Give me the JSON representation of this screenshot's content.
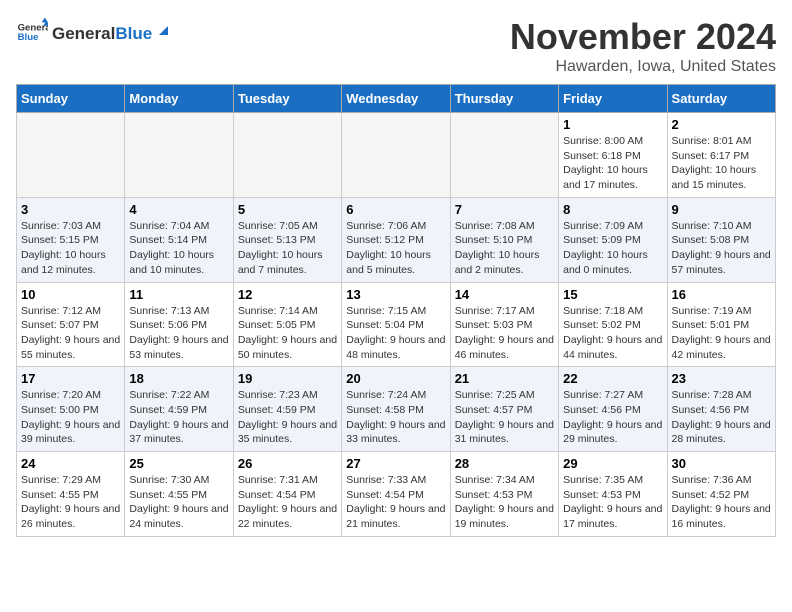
{
  "logo": {
    "general": "General",
    "blue": "Blue"
  },
  "header": {
    "month": "November 2024",
    "location": "Hawarden, Iowa, United States"
  },
  "weekdays": [
    "Sunday",
    "Monday",
    "Tuesday",
    "Wednesday",
    "Thursday",
    "Friday",
    "Saturday"
  ],
  "weeks": [
    [
      {
        "day": "",
        "text": ""
      },
      {
        "day": "",
        "text": ""
      },
      {
        "day": "",
        "text": ""
      },
      {
        "day": "",
        "text": ""
      },
      {
        "day": "",
        "text": ""
      },
      {
        "day": "1",
        "text": "Sunrise: 8:00 AM\nSunset: 6:18 PM\nDaylight: 10 hours and 17 minutes."
      },
      {
        "day": "2",
        "text": "Sunrise: 8:01 AM\nSunset: 6:17 PM\nDaylight: 10 hours and 15 minutes."
      }
    ],
    [
      {
        "day": "3",
        "text": "Sunrise: 7:03 AM\nSunset: 5:15 PM\nDaylight: 10 hours and 12 minutes."
      },
      {
        "day": "4",
        "text": "Sunrise: 7:04 AM\nSunset: 5:14 PM\nDaylight: 10 hours and 10 minutes."
      },
      {
        "day": "5",
        "text": "Sunrise: 7:05 AM\nSunset: 5:13 PM\nDaylight: 10 hours and 7 minutes."
      },
      {
        "day": "6",
        "text": "Sunrise: 7:06 AM\nSunset: 5:12 PM\nDaylight: 10 hours and 5 minutes."
      },
      {
        "day": "7",
        "text": "Sunrise: 7:08 AM\nSunset: 5:10 PM\nDaylight: 10 hours and 2 minutes."
      },
      {
        "day": "8",
        "text": "Sunrise: 7:09 AM\nSunset: 5:09 PM\nDaylight: 10 hours and 0 minutes."
      },
      {
        "day": "9",
        "text": "Sunrise: 7:10 AM\nSunset: 5:08 PM\nDaylight: 9 hours and 57 minutes."
      }
    ],
    [
      {
        "day": "10",
        "text": "Sunrise: 7:12 AM\nSunset: 5:07 PM\nDaylight: 9 hours and 55 minutes."
      },
      {
        "day": "11",
        "text": "Sunrise: 7:13 AM\nSunset: 5:06 PM\nDaylight: 9 hours and 53 minutes."
      },
      {
        "day": "12",
        "text": "Sunrise: 7:14 AM\nSunset: 5:05 PM\nDaylight: 9 hours and 50 minutes."
      },
      {
        "day": "13",
        "text": "Sunrise: 7:15 AM\nSunset: 5:04 PM\nDaylight: 9 hours and 48 minutes."
      },
      {
        "day": "14",
        "text": "Sunrise: 7:17 AM\nSunset: 5:03 PM\nDaylight: 9 hours and 46 minutes."
      },
      {
        "day": "15",
        "text": "Sunrise: 7:18 AM\nSunset: 5:02 PM\nDaylight: 9 hours and 44 minutes."
      },
      {
        "day": "16",
        "text": "Sunrise: 7:19 AM\nSunset: 5:01 PM\nDaylight: 9 hours and 42 minutes."
      }
    ],
    [
      {
        "day": "17",
        "text": "Sunrise: 7:20 AM\nSunset: 5:00 PM\nDaylight: 9 hours and 39 minutes."
      },
      {
        "day": "18",
        "text": "Sunrise: 7:22 AM\nSunset: 4:59 PM\nDaylight: 9 hours and 37 minutes."
      },
      {
        "day": "19",
        "text": "Sunrise: 7:23 AM\nSunset: 4:59 PM\nDaylight: 9 hours and 35 minutes."
      },
      {
        "day": "20",
        "text": "Sunrise: 7:24 AM\nSunset: 4:58 PM\nDaylight: 9 hours and 33 minutes."
      },
      {
        "day": "21",
        "text": "Sunrise: 7:25 AM\nSunset: 4:57 PM\nDaylight: 9 hours and 31 minutes."
      },
      {
        "day": "22",
        "text": "Sunrise: 7:27 AM\nSunset: 4:56 PM\nDaylight: 9 hours and 29 minutes."
      },
      {
        "day": "23",
        "text": "Sunrise: 7:28 AM\nSunset: 4:56 PM\nDaylight: 9 hours and 28 minutes."
      }
    ],
    [
      {
        "day": "24",
        "text": "Sunrise: 7:29 AM\nSunset: 4:55 PM\nDaylight: 9 hours and 26 minutes."
      },
      {
        "day": "25",
        "text": "Sunrise: 7:30 AM\nSunset: 4:55 PM\nDaylight: 9 hours and 24 minutes."
      },
      {
        "day": "26",
        "text": "Sunrise: 7:31 AM\nSunset: 4:54 PM\nDaylight: 9 hours and 22 minutes."
      },
      {
        "day": "27",
        "text": "Sunrise: 7:33 AM\nSunset: 4:54 PM\nDaylight: 9 hours and 21 minutes."
      },
      {
        "day": "28",
        "text": "Sunrise: 7:34 AM\nSunset: 4:53 PM\nDaylight: 9 hours and 19 minutes."
      },
      {
        "day": "29",
        "text": "Sunrise: 7:35 AM\nSunset: 4:53 PM\nDaylight: 9 hours and 17 minutes."
      },
      {
        "day": "30",
        "text": "Sunrise: 7:36 AM\nSunset: 4:52 PM\nDaylight: 9 hours and 16 minutes."
      }
    ]
  ]
}
